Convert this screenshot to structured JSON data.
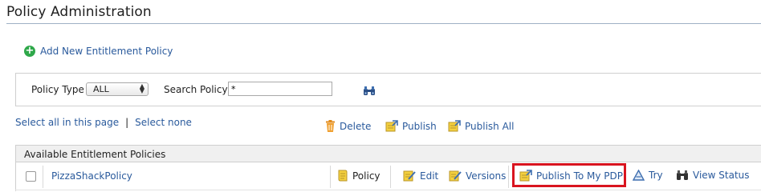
{
  "page": {
    "title": "Policy Administration"
  },
  "add_policy": {
    "label": "Add New Entitlement Policy"
  },
  "filter": {
    "policy_type_label": "Policy Type",
    "policy_type_value": "ALL",
    "search_label": "Search Policy",
    "search_value": "*"
  },
  "selection": {
    "select_all": "Select all in this page",
    "separator": "|",
    "select_none": "Select none"
  },
  "bulk_actions": {
    "delete": "Delete",
    "publish": "Publish",
    "publish_all": "Publish All"
  },
  "table": {
    "header": "Available Entitlement Policies",
    "rows": [
      {
        "name": "PizzaShackPolicy",
        "type": "Policy",
        "actions": {
          "edit": "Edit",
          "versions": "Versions",
          "publish_to_pdp": "Publish To My PDP",
          "try": "Try",
          "view_status": "View Status"
        }
      }
    ]
  },
  "colors": {
    "link": "#2a5a9c",
    "highlight": "#d9141f",
    "add_icon": "#2fa84a"
  }
}
